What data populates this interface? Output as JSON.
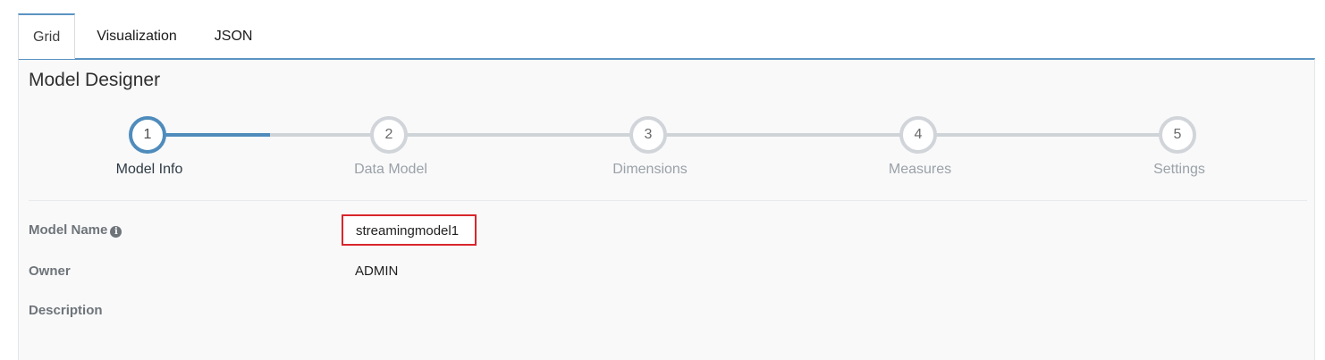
{
  "tabs": {
    "grid": "Grid",
    "visualization": "Visualization",
    "json": "JSON"
  },
  "panel": {
    "title": "Model Designer"
  },
  "wizard": {
    "current_step": 1,
    "steps": [
      {
        "number": "1",
        "label": "Model Info"
      },
      {
        "number": "2",
        "label": "Data Model"
      },
      {
        "number": "3",
        "label": "Dimensions"
      },
      {
        "number": "4",
        "label": "Measures"
      },
      {
        "number": "5",
        "label": "Settings"
      }
    ]
  },
  "form": {
    "model_name_label": "Model Name",
    "model_name_value": "streamingmodel1",
    "owner_label": "Owner",
    "owner_value": "ADMIN",
    "description_label": "Description",
    "info_icon_glyph": "i"
  },
  "colors": {
    "accent": "#4f8cbc",
    "highlight_border": "#d9262c",
    "inactive_step": "#d1d5d9"
  }
}
